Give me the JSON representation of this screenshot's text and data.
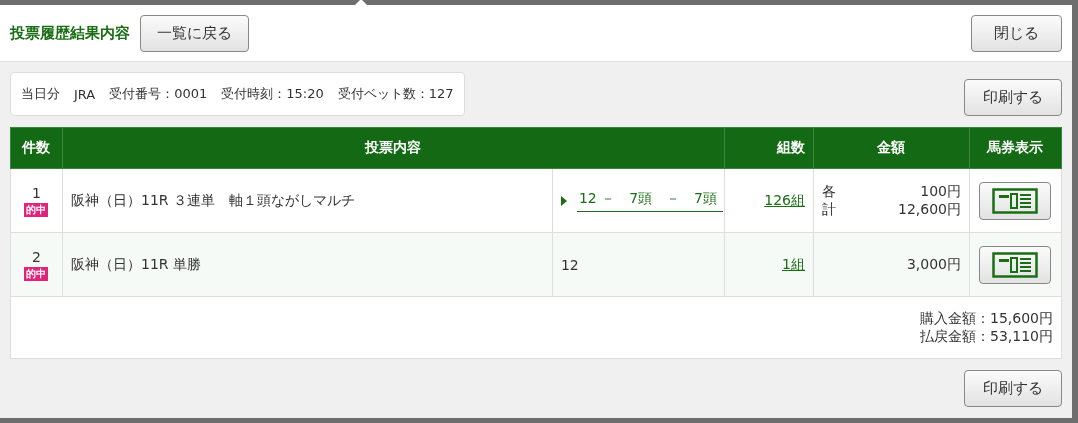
{
  "header": {
    "title": "投票履歴結果内容",
    "back_button": "一覧に戻る",
    "close_button": "閉じる"
  },
  "info": {
    "items": [
      "当日分",
      "JRA",
      "受付番号：0001",
      "受付時刻：15:20",
      "受付ベット数：127"
    ]
  },
  "print_button_top": "印刷する",
  "table": {
    "columns": [
      "件数",
      "投票内容",
      "組数",
      "金額",
      "馬券表示"
    ],
    "rows": [
      {
        "number": "1",
        "badge": "的中",
        "race": "阪神（日）11R ３連単　軸１頭ながしマルチ",
        "selection": {
          "kind": "link",
          "text": "12 －　7頭　－　7頭"
        },
        "combinations": "126組",
        "amounts": [
          {
            "label": "各",
            "value": "100円"
          },
          {
            "label": "計",
            "value": "12,600円"
          }
        ]
      },
      {
        "number": "2",
        "badge": "的中",
        "race": "阪神（日）11R 単勝",
        "selection": {
          "kind": "plain",
          "text": "12"
        },
        "combinations": "1組",
        "amounts": [
          {
            "value": "3,000円"
          }
        ]
      }
    ],
    "totals": [
      "購入金額：15,600円",
      "払戻金額：53,110円"
    ]
  },
  "print_button_bottom": "印刷する"
}
